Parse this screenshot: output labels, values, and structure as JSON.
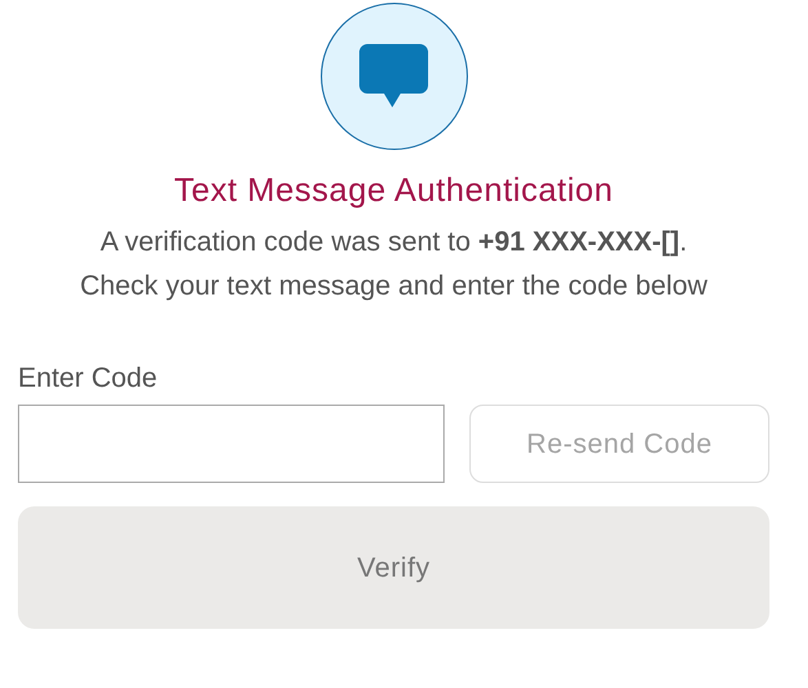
{
  "title": "Text Message Authentication",
  "message": [
    "A verification code was sent to **+91 XXX-XXX-[]**.",
    "Check your text message and enter the code below"
  ],
  "code_field": {
    "label": "Enter Code"
  },
  "resend_button": {
    "label": "Re-send Code",
    "disabled": true
  },
  "verify_button": {
    "label": "Verify",
    "disabled": true
  }
}
